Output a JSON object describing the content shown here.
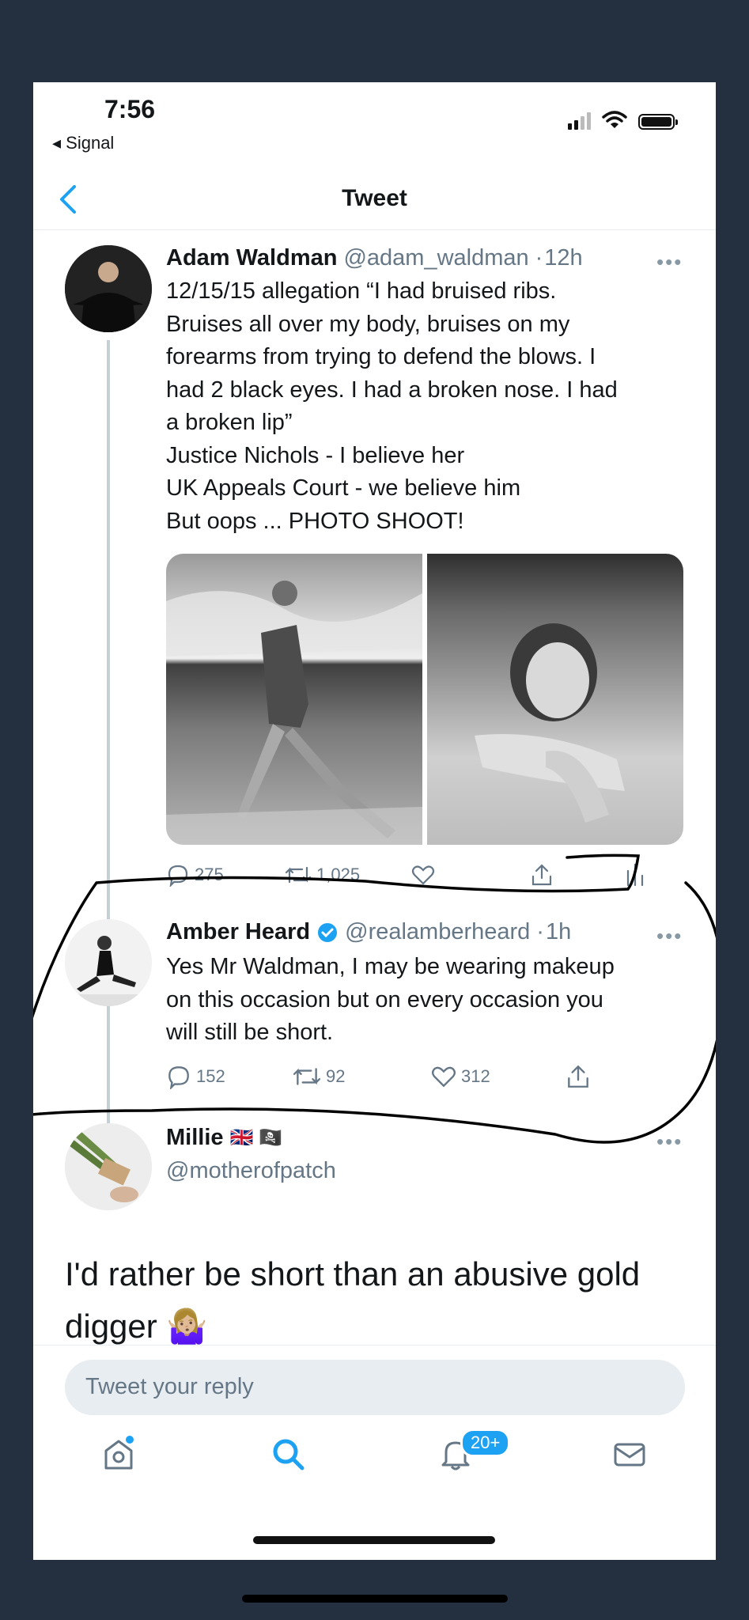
{
  "status_bar": {
    "time": "7:56",
    "back_app": "◂ Signal"
  },
  "nav": {
    "title": "Tweet"
  },
  "main_tweet": {
    "name": "Adam Waldman",
    "handle": "@adam_waldman",
    "sep": "·",
    "time": "12h",
    "more": "•••",
    "text": "12/15/15 allegation “I had bruised ribs.\nBruises all over my body, bruises on my\nforearms from trying to defend the blows. I\nhad 2 black eyes. I had a broken nose. I had\na broken lip”\nJustice Nichols - I believe her\nUK Appeals Court - we believe him\nBut oops ... PHOTO SHOOT!",
    "replies": "275",
    "retweets": "1,025"
  },
  "reply_tweet": {
    "name": "Amber Heard",
    "handle": "@realamberheard",
    "sep": "·",
    "time": "1h",
    "more": "•••",
    "text": "Yes Mr Waldman, I may be wearing makeup\non this occasion but on every occasion you\nwill still be short.",
    "replies": "152",
    "retweets": "92",
    "likes": "312"
  },
  "third_tweet": {
    "name": "Millie",
    "flags": "🇬🇧 🏴‍☠️",
    "handle": "@motherofpatch",
    "more": "•••",
    "text": "I'd rather be short than an abusive gold\ndigger 🤷🏼‍♀️"
  },
  "reply_box": {
    "placeholder": "Tweet your reply"
  },
  "tabbar": {
    "notifications_badge": "20+"
  },
  "colors": {
    "accent": "#1da1f2",
    "secondary_text": "#657786",
    "annotation": "#000000"
  },
  "icons": [
    "chevron-left-icon",
    "signal-icon",
    "wifi-icon",
    "battery-icon",
    "more-icon",
    "verified-icon",
    "reply-icon",
    "retweet-icon",
    "like-icon",
    "share-icon",
    "analytics-icon",
    "home-icon",
    "search-icon",
    "bell-icon",
    "mail-icon"
  ]
}
